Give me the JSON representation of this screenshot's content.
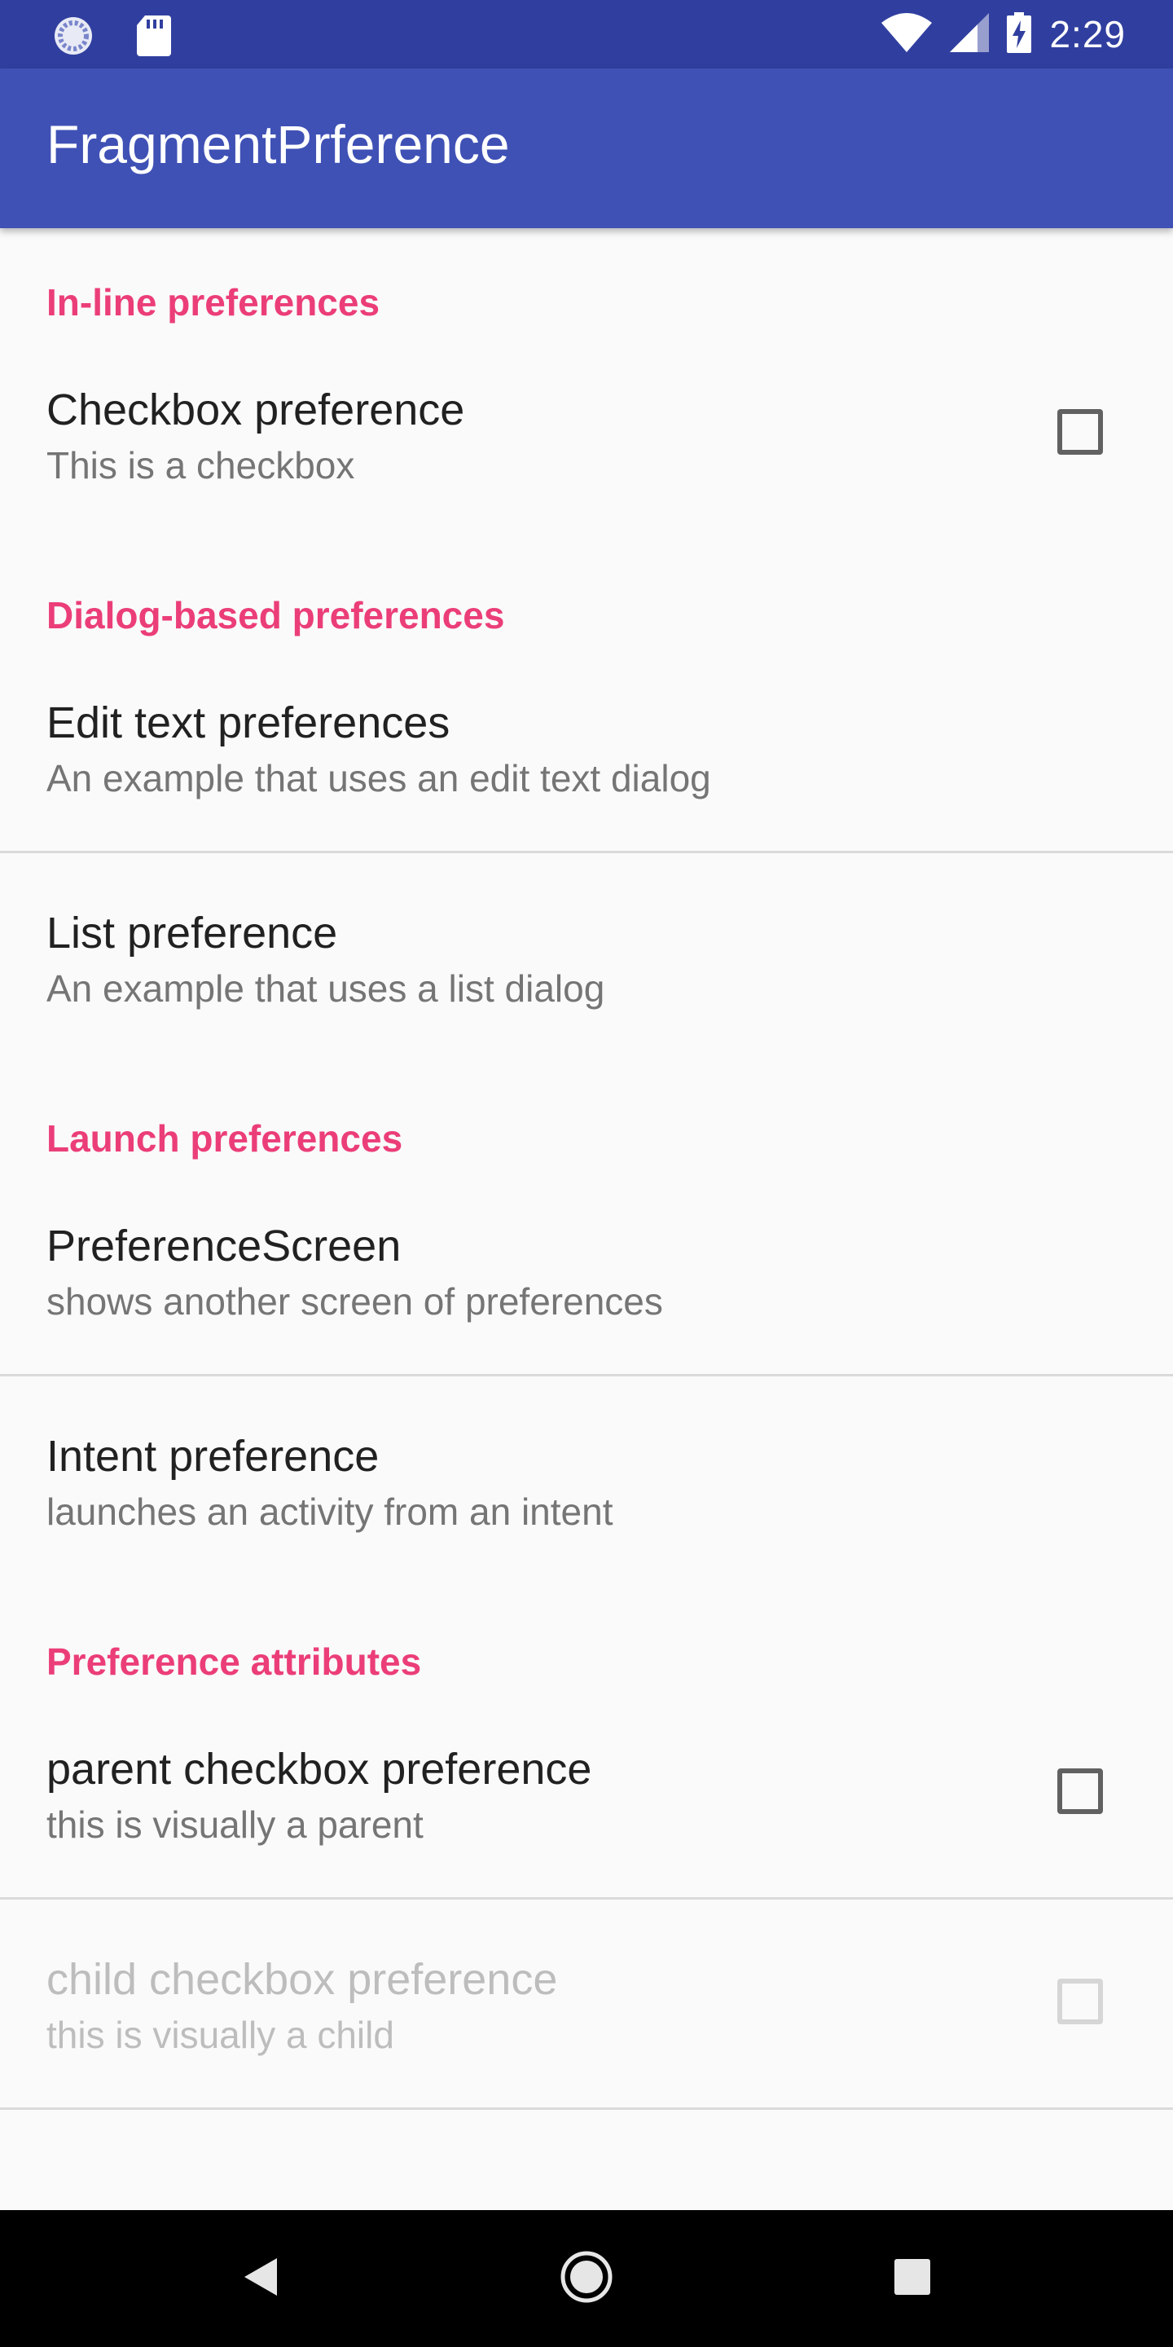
{
  "status_bar": {
    "time": "2:29",
    "left_icons": [
      "sync-icon",
      "sd-card-icon"
    ],
    "right_icons": [
      "wifi-icon",
      "cell-signal-icon",
      "battery-charging-icon"
    ]
  },
  "app_bar": {
    "title": "FragmentPrference"
  },
  "colors": {
    "status_bar": "#303F9F",
    "app_bar": "#3F51B5",
    "accent": "#E91E63"
  },
  "sections": {
    "inline": {
      "header": "In-line preferences",
      "checkbox_pref": {
        "title": "Checkbox preference",
        "summary": "This is a checkbox",
        "checked": false
      }
    },
    "dialog": {
      "header": "Dialog-based preferences",
      "edit_text_pref": {
        "title": "Edit text preferences",
        "summary": "An example that uses an edit text dialog"
      },
      "list_pref": {
        "title": "List preference",
        "summary": "An example that uses a list dialog"
      }
    },
    "launch": {
      "header": "Launch preferences",
      "screen_pref": {
        "title": "PreferenceScreen",
        "summary": "shows another screen of preferences"
      },
      "intent_pref": {
        "title": "Intent preference",
        "summary": "launches an activity from an intent"
      }
    },
    "attributes": {
      "header": "Preference attributes",
      "parent_pref": {
        "title": "parent checkbox preference",
        "summary": "this is visually a parent",
        "checked": false
      },
      "child_pref": {
        "title": "child checkbox preference",
        "summary": "this is visually a child",
        "checked": false,
        "enabled": false
      }
    }
  },
  "nav_bar": {
    "buttons": [
      "back-icon",
      "home-icon",
      "recents-icon"
    ]
  }
}
